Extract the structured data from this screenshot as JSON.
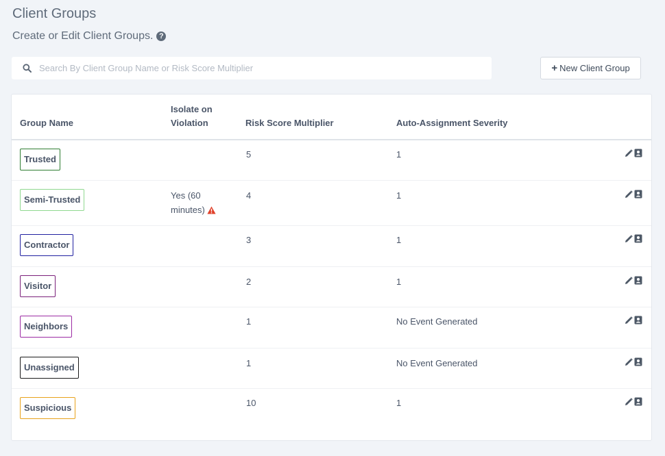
{
  "page": {
    "title": "Client Groups",
    "subtitle": "Create or Edit Client Groups.",
    "help_icon": "question-circle-icon"
  },
  "search": {
    "placeholder": "Search By Client Group Name or Risk Score Multiplier",
    "value": "",
    "icon": "search-icon"
  },
  "toolbar": {
    "new_group_plus": "+",
    "new_group_label": "New Client Group"
  },
  "table": {
    "headers": {
      "group_name": "Group Name",
      "isolate_line1": "Isolate on",
      "isolate_line2": "Violation",
      "risk_multiplier": "Risk Score Multiplier",
      "auto_severity": "Auto-Assignment Severity"
    },
    "rows": [
      {
        "name": "Trusted",
        "color": "#2f7d32",
        "isolate_line1": "",
        "isolate_line2": "",
        "isolate_warning": false,
        "risk": "5",
        "severity": "1"
      },
      {
        "name": "Semi-Trusted",
        "color": "#8fd88f",
        "isolate_line1": "Yes (60",
        "isolate_line2": "minutes)",
        "isolate_warning": true,
        "risk": "4",
        "severity": "1"
      },
      {
        "name": "Contractor",
        "color": "#1f1fa0",
        "isolate_line1": "",
        "isolate_line2": "",
        "isolate_warning": false,
        "risk": "3",
        "severity": "1"
      },
      {
        "name": "Visitor",
        "color": "#7a1f7a",
        "isolate_line1": "",
        "isolate_line2": "",
        "isolate_warning": false,
        "risk": "2",
        "severity": "1"
      },
      {
        "name": "Neighbors",
        "color": "#9b2aa3",
        "isolate_line1": "",
        "isolate_line2": "",
        "isolate_warning": false,
        "risk": "1",
        "severity": "No Event Generated"
      },
      {
        "name": "Unassigned",
        "color": "#1a1a1a",
        "isolate_line1": "",
        "isolate_line2": "",
        "isolate_warning": false,
        "risk": "1",
        "severity": "No Event Generated"
      },
      {
        "name": "Suspicious",
        "color": "#e8a21a",
        "isolate_line1": "",
        "isolate_line2": "",
        "isolate_warning": false,
        "risk": "10",
        "severity": "1"
      }
    ],
    "row_action_icons": [
      "pencil-icon",
      "contact-card-icon"
    ]
  },
  "colors": {
    "background": "#f1f4f8",
    "warning": "#e0402a",
    "text": "#4a5568"
  }
}
